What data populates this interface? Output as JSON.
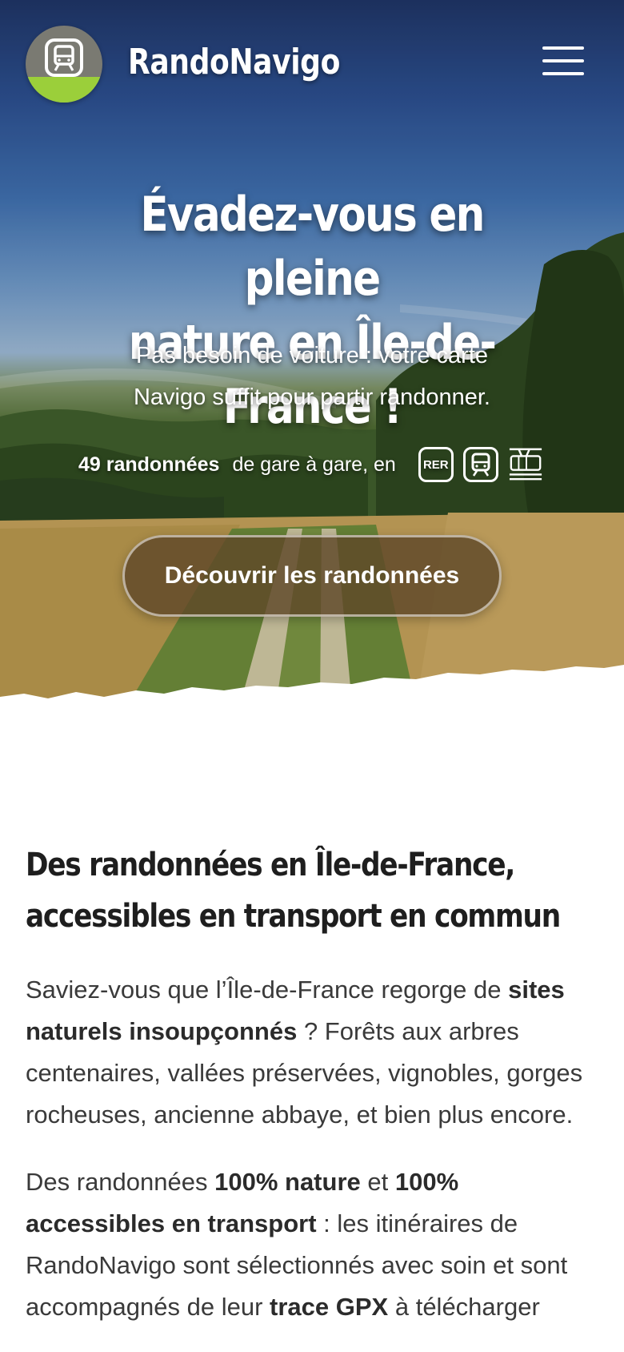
{
  "header": {
    "brand": "RandoNavigo",
    "logo_icon": "train-icon",
    "menu_icon": "hamburger-menu-icon"
  },
  "hero": {
    "title_line1": "Évadez-vous en pleine",
    "title_line2": "nature en Île-de-France !",
    "subtitle_line1": "Pas besoin de voiture : votre carte",
    "subtitle_line2": "Navigo suffit pour partir randonner.",
    "count": "49 randonnées",
    "count_suffix": "de gare à gare, en",
    "transport_badges": [
      {
        "icon": "rer-icon",
        "label": "RER"
      },
      {
        "icon": "train-icon",
        "label": ""
      },
      {
        "icon": "tram-icon",
        "label": ""
      }
    ],
    "cta_label": "Découvrir les randonnées"
  },
  "section": {
    "title_line1": "Des randonnées en Île-de-France,",
    "title_line2": "accessibles en transport en commun",
    "p1": {
      "t1": "Saviez-vous que l’Île-de-France regorge de ",
      "b1": "sites naturels insoupçonnés",
      "t2": " ? Forêts aux arbres centenaires, vallées préservées, vignobles, gorges rocheuses, ancienne abbaye, et bien plus encore."
    },
    "p2": {
      "t1": "Des randonnées ",
      "b1": "100% nature",
      "t2": " et ",
      "b2": "100% accessibles en transport",
      "t3": " : les itinéraires de RandoNavigo sont sélectionnés avec soin et sont accompagnés de leur ",
      "b3": "trace GPX",
      "t4": " à télécharger"
    }
  },
  "colors": {
    "logo_bg": "#7a7a72",
    "logo_grass": "#9bcf3a",
    "cta_bg": "#5f4828",
    "text_dark": "#1e1e1e"
  }
}
